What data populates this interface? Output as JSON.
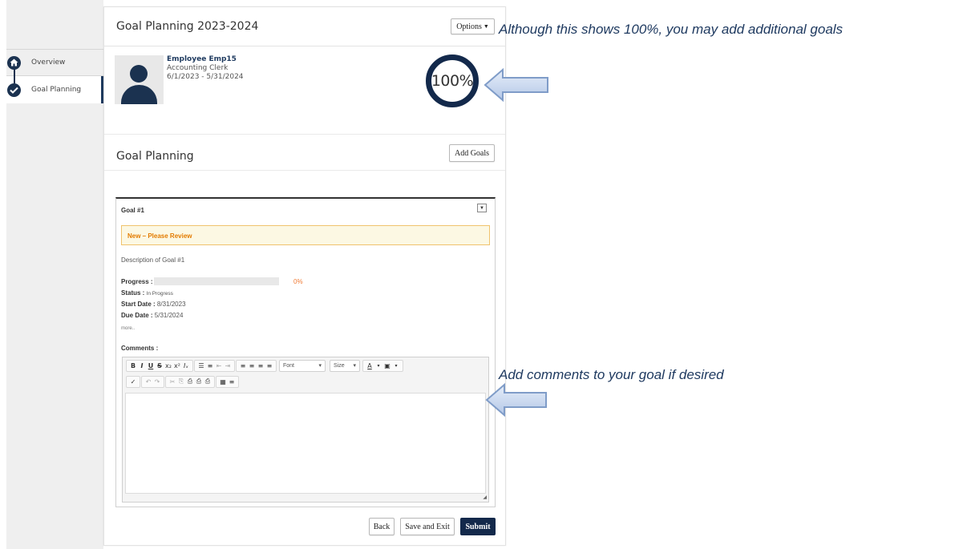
{
  "sidebar": {
    "items": [
      {
        "label": "Overview",
        "icon": "home-icon"
      },
      {
        "label": "Goal Planning",
        "icon": "check-icon",
        "active": true
      }
    ]
  },
  "header": {
    "title": "Goal Planning 2023-2024",
    "options_label": "Options"
  },
  "employee": {
    "name": "Employee Emp15",
    "job_title": "Accounting Clerk",
    "period": "6/1/2023 - 5/31/2024",
    "completion": "100%"
  },
  "goal_section": {
    "title": "Goal Planning",
    "add_label": "Add Goals"
  },
  "goal": {
    "title": "Goal #1",
    "banner": "New – Please Review",
    "description": "Description of Goal #1",
    "progress_label": "Progress :",
    "progress_value": "0%",
    "progress_fraction": 0,
    "status_label": "Status :",
    "status_value": "In Progress",
    "start_label": "Start Date :",
    "start_value": "8/31/2023",
    "due_label": "Due Date :",
    "due_value": "5/31/2024",
    "more_label": "more..",
    "comments_label": "Comments :"
  },
  "editor": {
    "font_label": "Font",
    "size_label": "Size",
    "row1": [
      "B",
      "I",
      "U",
      "S",
      "x₂",
      "x²",
      "Iₓ",
      "☰",
      "≡",
      "⇤",
      "⇥",
      "≡",
      "≡",
      "≡",
      "≡",
      "A",
      "▣"
    ],
    "row2": [
      "✓",
      "↶",
      "↷",
      "✂",
      "⎘",
      "⎙",
      "⎙",
      "⎙",
      "▦",
      "≡"
    ]
  },
  "footer": {
    "back_label": "Back",
    "save_exit_label": "Save and Exit",
    "submit_label": "Submit"
  },
  "annotations": {
    "top": "Although this shows 100%, you may add additional goals",
    "bottom": "Add comments to your goal if desired"
  },
  "colors": {
    "navy": "#13294b",
    "orange": "#f07b35",
    "banner_bg": "#fcf8e3",
    "annotation": "#1f3a60"
  }
}
